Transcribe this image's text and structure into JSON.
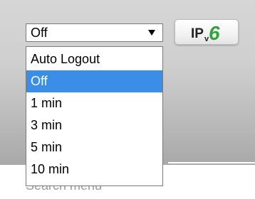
{
  "auto_logout": {
    "selected_value": "Off",
    "options": [
      "Auto Logout",
      "Off",
      "1 min",
      "3 min",
      "5 min",
      "10 min"
    ],
    "highlighted_option": "Off"
  },
  "ipv6_badge": {
    "text_prefix": "IP",
    "text_v": "v",
    "text_6": "6",
    "colors": {
      "prefix": "#222222",
      "six": "#2ea43a"
    }
  },
  "background": {
    "search_text": "Search menu"
  }
}
